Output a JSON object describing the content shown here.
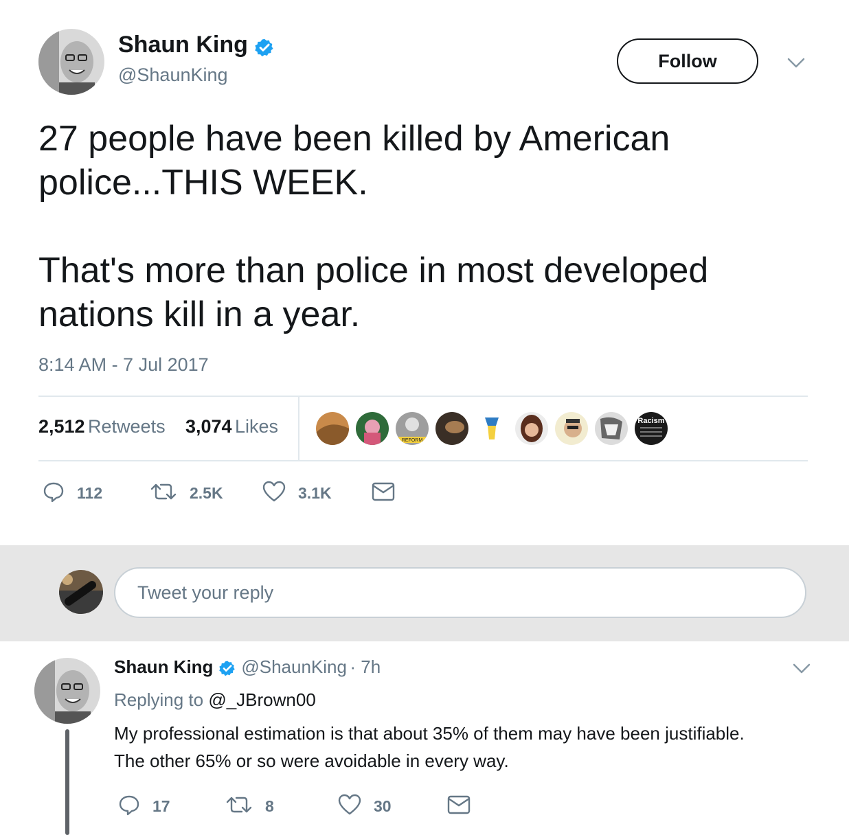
{
  "tweet": {
    "author_name": "Shaun King",
    "author_handle": "@ShaunKing",
    "follow_label": "Follow",
    "text_para1": "27 people have been killed by American police...THIS WEEK.",
    "text_para2": "That's more than police in most developed nations kill in a year.",
    "timestamp": "8:14 AM - 7 Jul 2017",
    "retweets_count": "2,512",
    "retweets_label": "Retweets",
    "likes_count": "3,074",
    "likes_label": "Likes",
    "liker_avatars": [
      "avatar-1",
      "avatar-2",
      "avatar-3",
      "avatar-4",
      "avatar-5",
      "avatar-6",
      "avatar-7",
      "avatar-8",
      "avatar-9"
    ],
    "liker_badge_text": "Racism",
    "liker_logo_text": "REFORM",
    "actions": {
      "reply_count": "112",
      "retweet_count": "2.5K",
      "like_count": "3.1K"
    }
  },
  "reply_box": {
    "placeholder": "Tweet your reply"
  },
  "reply": {
    "author_name": "Shaun King",
    "author_handle": "@ShaunKing",
    "time": "· 7h",
    "replying_label": "Replying to",
    "replying_to": "@_JBrown00",
    "text_line1": "My professional estimation is that about 35% of them may have been justifiable.",
    "text_line2": "The other 65% or so were avoidable in every way.",
    "actions": {
      "reply_count": "17",
      "retweet_count": "8",
      "like_count": "30"
    }
  },
  "colors": {
    "verified": "#1da1f2",
    "secondary_text": "#657786",
    "reply_bar_bg": "#e6e6e6"
  }
}
